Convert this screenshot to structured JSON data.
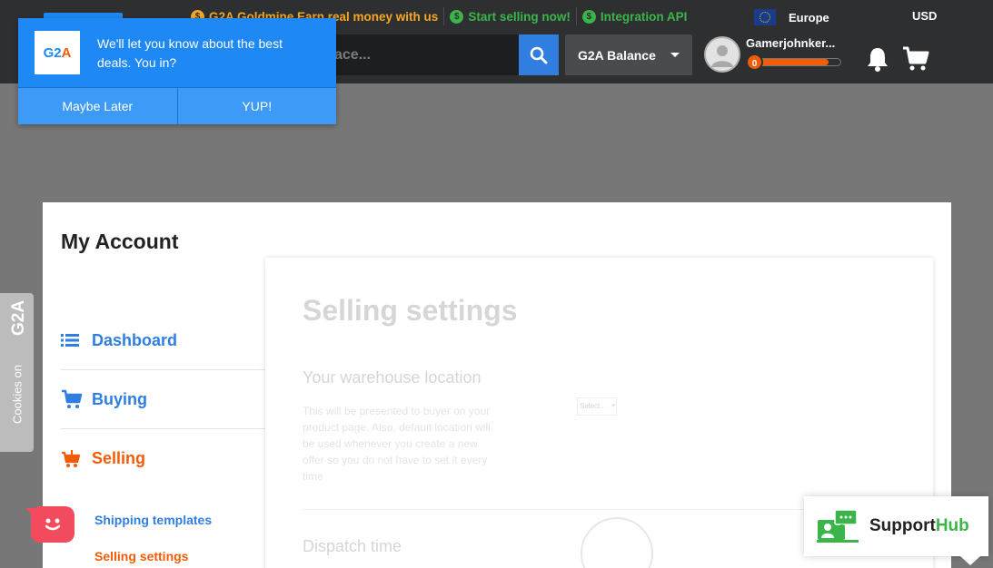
{
  "topbar": {
    "links": [
      {
        "label": "G2A Goldmine Earn real money with us",
        "style": "gold"
      },
      {
        "label": "Start selling now!",
        "style": "green"
      },
      {
        "label": "Integration API",
        "style": "green"
      }
    ],
    "region": "Europe",
    "currency": "USD",
    "search_placeholder": "ace...",
    "balance_label": "G2A Balance",
    "username": "Gamerjohnker...",
    "level": "0",
    "xp_progress_percent": 85
  },
  "notification": {
    "logo_g2": "G2",
    "logo_a": "A",
    "message": "We'll let you know about the best deals. You in?",
    "decline_label": "Maybe Later",
    "accept_label": "YUP!"
  },
  "account": {
    "title": "My Account",
    "nav": [
      {
        "label": "Dashboard",
        "icon": "list-icon"
      },
      {
        "label": "Buying",
        "icon": "cart-icon"
      },
      {
        "label": "Selling",
        "icon": "selling-cart-icon",
        "active": true
      }
    ],
    "sub_nav": [
      {
        "label": "Shipping templates"
      },
      {
        "label": "Selling settings",
        "active": true
      }
    ]
  },
  "selling_settings": {
    "title": "Selling settings",
    "warehouse_heading": "Your warehouse location",
    "warehouse_desc": "This will be presented to buyer on your product page. Also, default location will be used whenever you create a new offer so you do not have to set it every time",
    "select_value": "Select...",
    "dispatch_heading": "Dispatch time"
  },
  "cookies_tab": {
    "logo": "G2A",
    "label": "Cookies on"
  },
  "support_hub": {
    "label_support": "Support",
    "label_hub": "Hub"
  },
  "colors": {
    "topbar_bg": "#2e2f31",
    "brand_blue": "#1e88f5",
    "accent_orange": "#f25c05",
    "link_blue": "#2f7ee0",
    "success_green": "#3bb54a",
    "goldmine": "#f5a623",
    "chat_red": "#f24b5d"
  }
}
